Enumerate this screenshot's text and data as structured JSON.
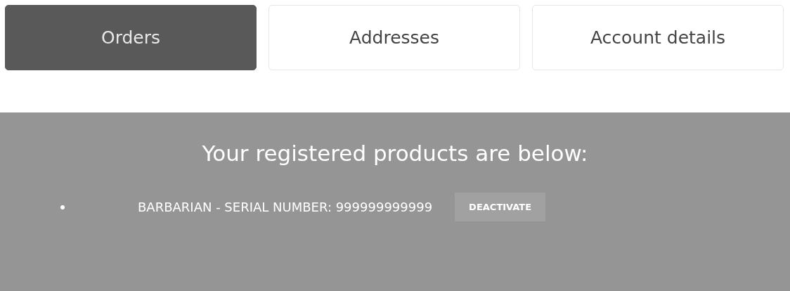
{
  "tabs": [
    {
      "label": "Orders",
      "selected": true
    },
    {
      "label": "Addresses",
      "selected": false
    },
    {
      "label": "Account details",
      "selected": false
    }
  ],
  "products_panel": {
    "title": "Your registered products are below:",
    "items": [
      {
        "text": "BARBARIAN - SERIAL NUMBER: 999999999999",
        "button": "DEACTIVATE"
      }
    ]
  }
}
